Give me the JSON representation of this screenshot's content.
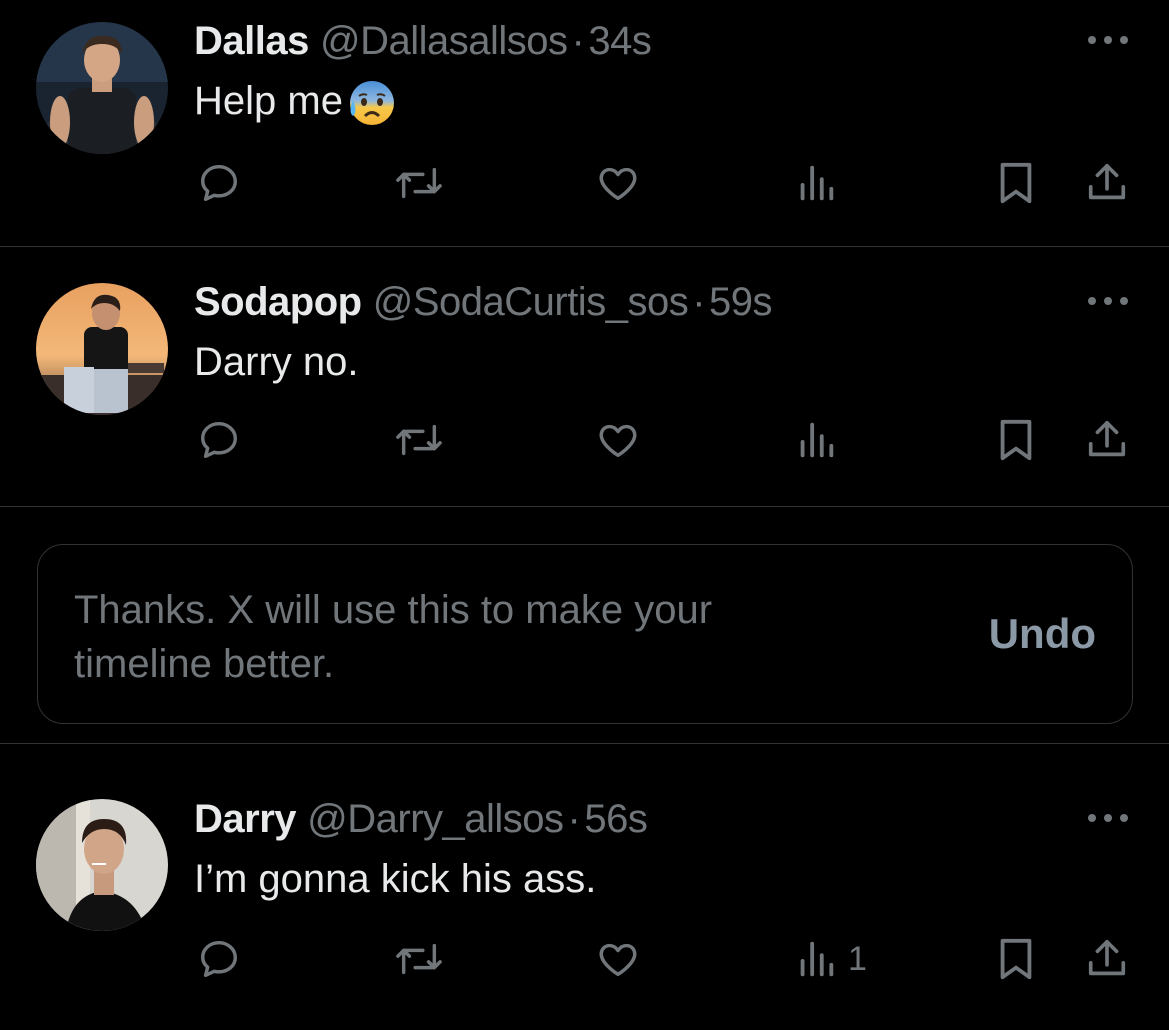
{
  "tweets": [
    {
      "name": "Dallas",
      "handle": "@Dallasallsos",
      "dot": "·",
      "time": "34s",
      "text": "Help me",
      "emoji": "anxious-face-with-sweat",
      "views": ""
    },
    {
      "name": "Sodapop",
      "handle": "@SodaCurtis_sos",
      "dot": "·",
      "time": "59s",
      "text": "Darry no.",
      "views": ""
    },
    {
      "name": "Darry",
      "handle": "@Darry_allsos",
      "dot": "·",
      "time": "56s",
      "text": "I’m gonna kick his ass.",
      "views": "1"
    }
  ],
  "notice": {
    "text": "Thanks. X will use this to make your timeline better.",
    "undo_label": "Undo"
  },
  "icons": {
    "reply": "reply-icon",
    "retweet": "retweet-icon",
    "like": "like-icon",
    "views": "views-icon",
    "bookmark": "bookmark-icon",
    "share": "share-icon",
    "more": "more-icon"
  },
  "colors": {
    "background": "#000000",
    "primary_text": "#e7e9ea",
    "secondary_text": "#71767b",
    "border": "#2f3336",
    "undo": "#8b98a5"
  }
}
